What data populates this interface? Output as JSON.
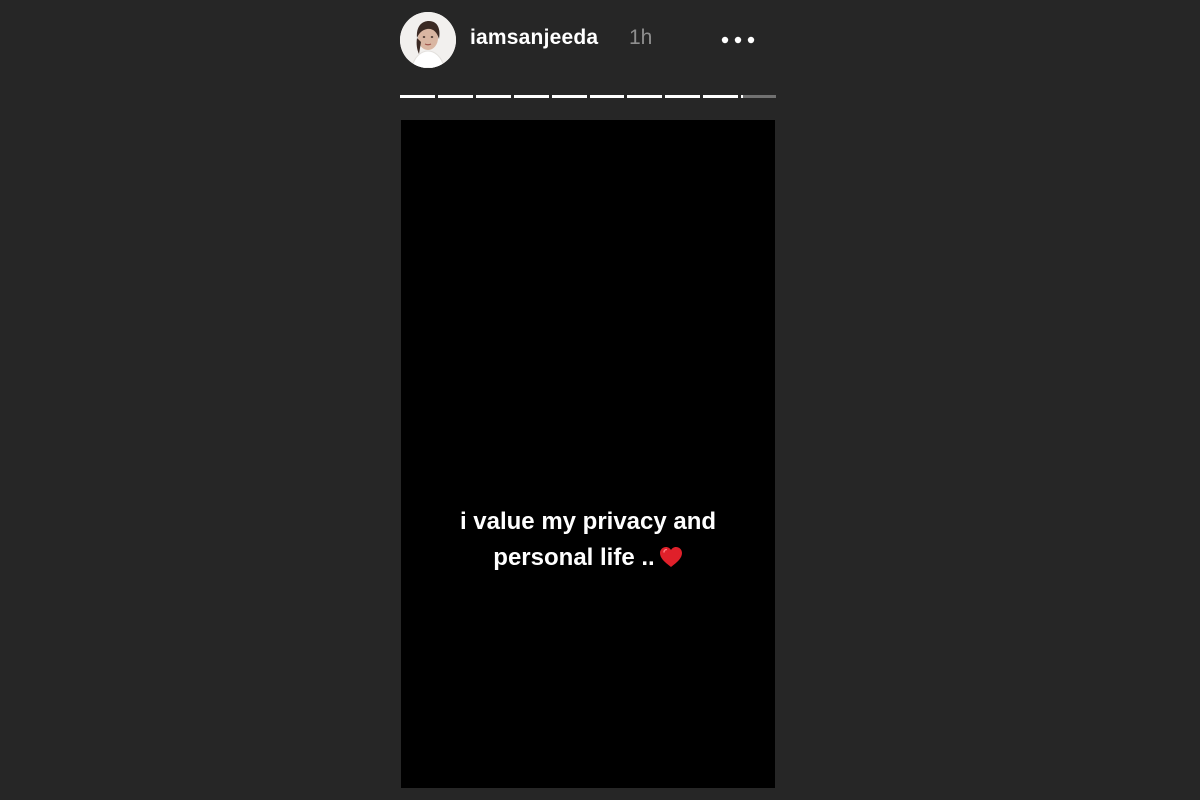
{
  "story": {
    "username": "iamsanjeeda",
    "time_ago": "1h",
    "text_lines": [
      "i value my privacy and",
      "personal life .."
    ],
    "emoji_icon": "red-heart-icon"
  },
  "progress": {
    "segments_total": 10,
    "current_index": 9,
    "current_fraction": 0.05
  },
  "icons": {
    "avatar": "profile-photo",
    "more": "more-options-icon"
  },
  "colors": {
    "background": "#262626",
    "story_bg": "#000000",
    "text": "#ffffff",
    "timestamp": "#8e8e8e",
    "heart": "#e0202a"
  }
}
